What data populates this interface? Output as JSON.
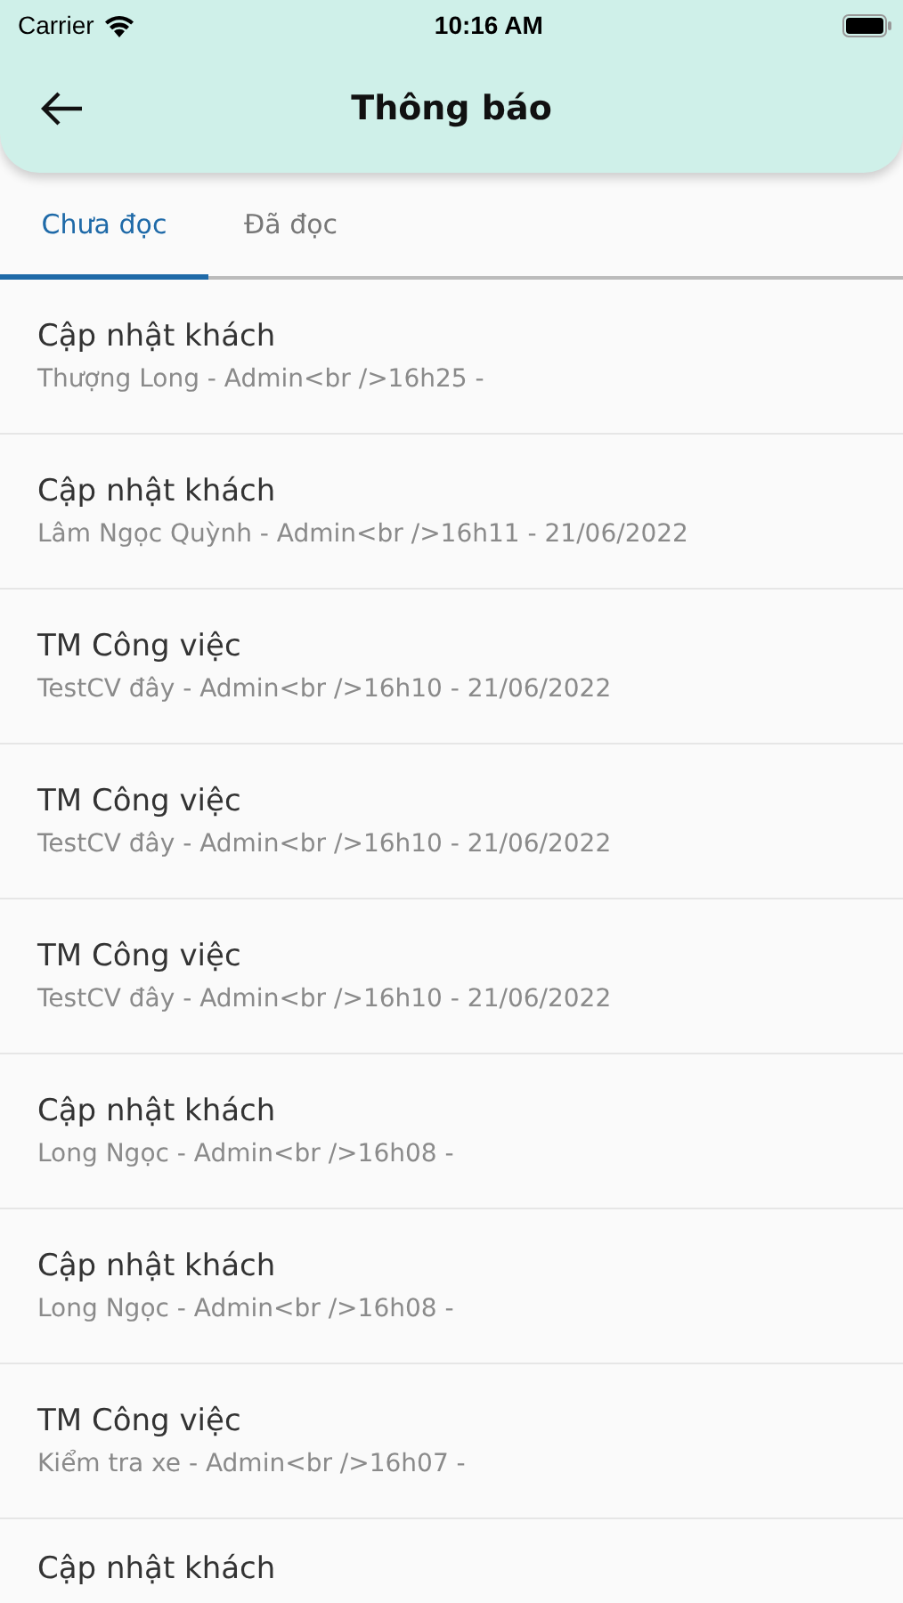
{
  "status_bar": {
    "carrier": "Carrier",
    "time": "10:16 AM"
  },
  "header": {
    "title": "Thông báo"
  },
  "tabs": [
    {
      "label": "Chưa đọc",
      "selected": true
    },
    {
      "label": "Đã đọc",
      "selected": false
    }
  ],
  "notifications": [
    {
      "title": "Cập nhật khách",
      "detail": "Thượng Long - Admin<br />16h25 -"
    },
    {
      "title": "Cập nhật khách",
      "detail": "Lâm Ngọc Quỳnh - Admin<br />16h11 - 21/06/2022"
    },
    {
      "title": "TM Công việc",
      "detail": "TestCV đây - Admin<br />16h10 - 21/06/2022"
    },
    {
      "title": "TM Công việc",
      "detail": "TestCV đây - Admin<br />16h10 - 21/06/2022"
    },
    {
      "title": "TM Công việc",
      "detail": "TestCV đây - Admin<br />16h10 - 21/06/2022"
    },
    {
      "title": "Cập nhật khách",
      "detail": "Long Ngọc - Admin<br />16h08 -"
    },
    {
      "title": "Cập nhật khách",
      "detail": "Long Ngọc - Admin<br />16h08 -"
    },
    {
      "title": "TM Công việc",
      "detail": "Kiểm tra xe - Admin<br />16h07 -"
    },
    {
      "title": "Cập nhật khách"
    }
  ]
}
